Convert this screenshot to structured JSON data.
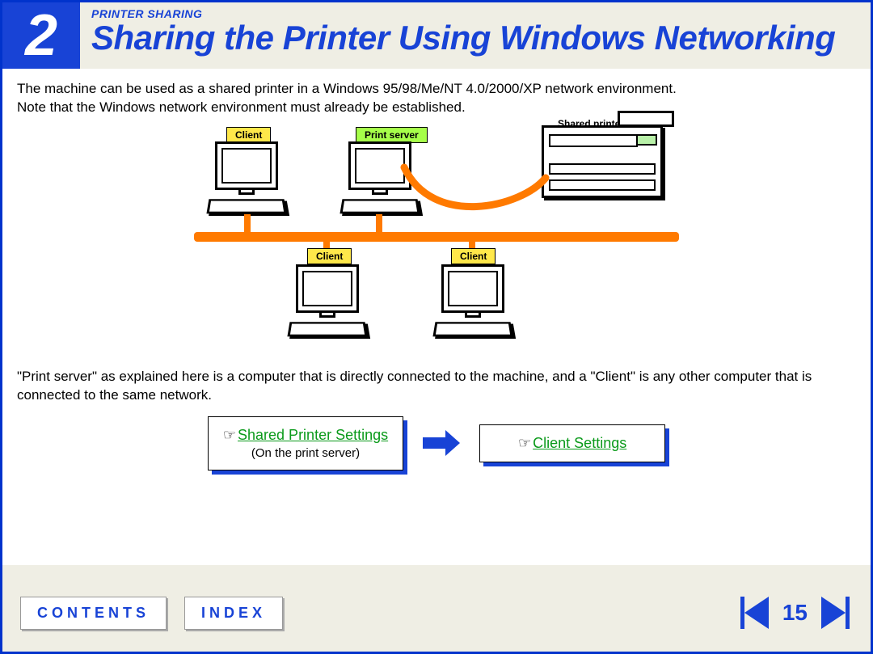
{
  "chapter_number": "2",
  "eyebrow": "PRINTER SHARING",
  "title": "Sharing the Printer Using Windows Networking",
  "intro_line1": "The machine can be used as a shared printer in a Windows 95/98/Me/NT 4.0/2000/XP network environment.",
  "intro_line2": "Note that the Windows network environment must already be established.",
  "labels": {
    "client": "Client",
    "print_server": "Print server",
    "shared_printer": "Shared printer"
  },
  "explain": "\"Print server\" as explained here is a computer that is directly connected to the machine, and a \"Client\" is any other computer that is connected to the same network.",
  "links": {
    "shared_settings": "Shared Printer Settings",
    "shared_sub": "(On the print server)",
    "client_settings": "Client Settings"
  },
  "footer": {
    "contents": "CONTENTS",
    "index": "INDEX",
    "page": "15"
  }
}
